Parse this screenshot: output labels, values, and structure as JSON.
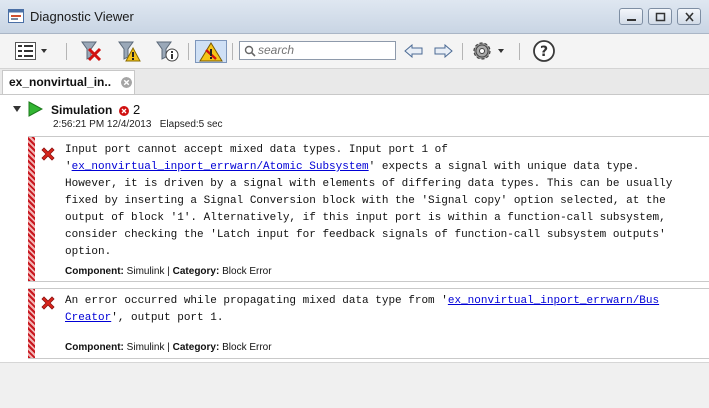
{
  "window": {
    "title": "Diagnostic Viewer"
  },
  "toolbar": {
    "search_placeholder": "search"
  },
  "tabs": [
    {
      "label": "ex_nonvirtual_in.."
    }
  ],
  "simulation": {
    "label": "Simulation",
    "error_count": "2",
    "timestamp": "2:56:21 PM 12/4/2013   Elapsed:5 sec"
  },
  "messages": [
    {
      "line1": "Input port cannot accept mixed data types. Input port 1 of",
      "line2_pre": "'",
      "link1": "ex_nonvirtual_inport_errwarn/Atomic Subsystem",
      "line2_post": "' expects a signal with unique data type.",
      "lines_rest": "However, it is driven by a signal with elements of differing data types. This can be usually\nfixed by inserting a Signal Conversion block with the 'Signal copy' option selected, at the\noutput of block '1'. Alternatively, if this input port is within a function-call subsystem,\nconsider checking the 'Latch input for feedback signals of function-call subsystem outputs'\noption.",
      "component_label": "Component:",
      "component_value": "Simulink",
      "separator": "|",
      "category_label": "Category:",
      "category_value": "Block Error"
    },
    {
      "line1_pre": "An error occurred while propagating mixed data type from '",
      "link1": "ex_nonvirtual_inport_errwarn/Bus",
      "link2": "Creator",
      "line2_post": "', output port 1.",
      "component_label": "Component:",
      "component_value": "Simulink",
      "separator": "|",
      "category_label": "Category:",
      "category_value": "Block Error"
    }
  ],
  "icons": {
    "app": "diagnostic-viewer-icon",
    "menu": "list-menu-icon",
    "clear_errors": "clear-errors-icon",
    "clear_warnings": "clear-warnings-icon",
    "clear_info": "clear-info-icon",
    "warning_toggle": "warning-filter-icon",
    "back": "arrow-left-icon",
    "forward": "arrow-right-icon",
    "settings": "gear-icon",
    "help": "help-icon"
  },
  "colors": {
    "error_red": "#d01010",
    "link_blue": "#0000d6",
    "run_green": "#2ea82e"
  }
}
